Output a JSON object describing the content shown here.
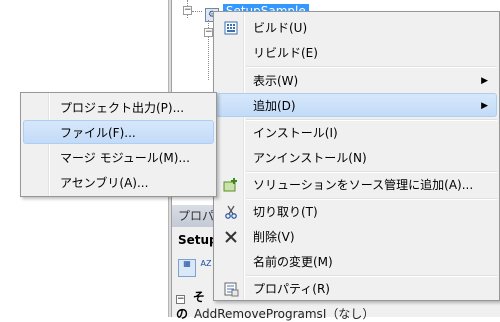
{
  "tree": {
    "project_label": "SetupSample"
  },
  "properties_panel": {
    "title_partial": "プロパ",
    "object_partial": "Setup",
    "category_partial": "その",
    "row_partial": "AddRemoveProgramsI（なし）"
  },
  "context_menu": {
    "items": [
      {
        "label": "ビルド(U)",
        "icon": "build-icon"
      },
      {
        "label": "リビルド(E)",
        "icon": ""
      },
      {
        "label": "表示(W)",
        "icon": "",
        "submenu": true
      },
      {
        "label": "追加(D)",
        "icon": "",
        "submenu": true,
        "highlighted": true
      },
      {
        "label": "インストール(I)",
        "icon": ""
      },
      {
        "label": "アンインストール(N)",
        "icon": ""
      },
      {
        "label": "ソリューションをソース管理に追加(A)...",
        "icon": "add-source-control-icon"
      },
      {
        "label": "切り取り(T)",
        "icon": "scissors-icon"
      },
      {
        "label": "削除(V)",
        "icon": "delete-x-icon"
      },
      {
        "label": "名前の変更(M)",
        "icon": ""
      },
      {
        "label": "プロパティ(R)",
        "icon": "properties-icon"
      }
    ]
  },
  "add_submenu": {
    "items": [
      {
        "label": "プロジェクト出力(P)..."
      },
      {
        "label": "ファイル(F)...",
        "highlighted": true
      },
      {
        "label": "マージ モジュール(M)..."
      },
      {
        "label": "アセンブリ(A)..."
      }
    ]
  },
  "colors": {
    "menu_bg": "#f0f0f0",
    "highlight": "#c3dbf7",
    "selection": "#3399ff"
  }
}
